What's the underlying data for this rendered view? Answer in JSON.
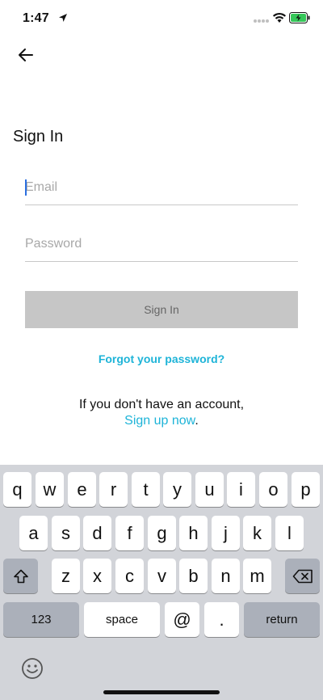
{
  "status_bar": {
    "time": "1:47"
  },
  "page": {
    "title": "Sign In"
  },
  "form": {
    "email_placeholder": "Email",
    "password_placeholder": "Password",
    "signin_label": "Sign In",
    "forgot_label": "Forgot your password?",
    "no_account_text": "If you don't have an account,",
    "signup_label": "Sign up now",
    "signup_suffix": "."
  },
  "colors": {
    "link": "#1eb4d8",
    "button_disabled": "#c6c6c6",
    "keyboard_bg": "#d2d4d9"
  },
  "keyboard": {
    "row1": [
      "q",
      "w",
      "e",
      "r",
      "t",
      "y",
      "u",
      "i",
      "o",
      "p"
    ],
    "row2": [
      "a",
      "s",
      "d",
      "f",
      "g",
      "h",
      "j",
      "k",
      "l"
    ],
    "row3": [
      "z",
      "x",
      "c",
      "v",
      "b",
      "n",
      "m"
    ],
    "numbers_label": "123",
    "space_label": "space",
    "at_label": "@",
    "dot_label": ".",
    "return_label": "return",
    "shift_icon": "shift-icon",
    "delete_icon": "backspace-icon",
    "emoji_icon": "emoji-icon"
  }
}
